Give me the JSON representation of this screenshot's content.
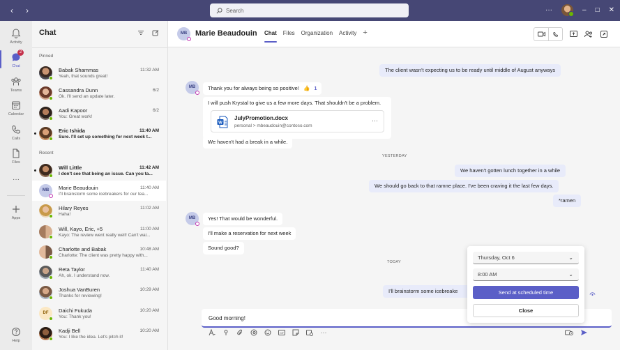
{
  "titlebar": {
    "back": "‹",
    "forward": "›",
    "search_placeholder": "Search",
    "more": "···",
    "minimize": "–",
    "maximize": "□",
    "close": "✕"
  },
  "rail": {
    "activity": "Activity",
    "chat": "Chat",
    "chat_badge": "2",
    "teams": "Teams",
    "calendar": "Calendar",
    "calls": "Calls",
    "files": "Files",
    "more": "···",
    "apps": "Apps",
    "help": "Help"
  },
  "chatlist": {
    "title": "Chat",
    "pinned_label": "Pinned",
    "recent_label": "Recent",
    "pinned": [
      {
        "name": "Babak Shammas",
        "time": "11:32 AM",
        "preview": "Yeah, that sounds great!",
        "bold": false
      },
      {
        "name": "Cassandra Dunn",
        "time": "6/2",
        "preview": "Ok. I'll send an update later.",
        "bold": false
      },
      {
        "name": "Aadi Kapoor",
        "time": "6/2",
        "preview": "You: Great work!",
        "bold": false
      },
      {
        "name": "Eric Ishida",
        "time": "11:40 AM",
        "preview": "Sure. I'll set up something for next week t...",
        "bold": true
      }
    ],
    "recent": [
      {
        "name": "Will Little",
        "time": "11:42 AM",
        "preview": "I don't see that being an issue. Can you ta...",
        "bold": true
      },
      {
        "name": "Marie Beaudouin",
        "time": "11:40 AM",
        "preview": "I'll brainstorm some icebreakers for our tea...",
        "bold": false,
        "initials": "MB"
      },
      {
        "name": "Hilary Reyes",
        "time": "11:02 AM",
        "preview": "Haha!",
        "bold": false
      },
      {
        "name": "Will, Kayo, Eric, +5",
        "time": "11:00 AM",
        "preview": "Kayo: The review went really well! Can't wai...",
        "bold": false
      },
      {
        "name": "Charlotte and Babak",
        "time": "10:48 AM",
        "preview": "Charlotte: The client was pretty happy with...",
        "bold": false
      },
      {
        "name": "Reta Taylor",
        "time": "11:40 AM",
        "preview": "Ah, ok. I understand now.",
        "bold": false
      },
      {
        "name": "Joshua VanBuren",
        "time": "10:29 AM",
        "preview": "Thanks for reviewing!",
        "bold": false
      },
      {
        "name": "Daichi Fukuda",
        "time": "10:20 AM",
        "preview": "You: Thank you!",
        "bold": false,
        "initials": "DF"
      },
      {
        "name": "Kadji Bell",
        "time": "10:20 AM",
        "preview": "You: I like the idea. Let's pitch it!",
        "bold": false
      }
    ]
  },
  "conversation": {
    "initials": "MB",
    "name": "Marie Beaudouin",
    "tabs": [
      "Chat",
      "Files",
      "Organization",
      "Activity"
    ],
    "add_tab": "+",
    "messages": {
      "out1": "The client wasn't expecting us to be ready until middle of August anyways",
      "in1": "Thank you for always being so positive!",
      "in1_reaction_emoji": "👍",
      "in1_reaction_count": "1",
      "in2": "I will push Krystal to give us a few more days. That shouldn't be a problem.",
      "file_name": "JulyPromotion.docx",
      "file_path": "personal > mbeaudouin@contoso.com",
      "file_more": "···",
      "in3": "We haven't had a break in a while.",
      "divider_yesterday": "YESTERDAY",
      "out2": "We haven't gotten lunch together in a while",
      "out3": "We should go back to that ramne place. I've been craving it the last few days.",
      "out4": "*ramen",
      "in4": "Yes! That would be wonderful.",
      "in5": "I'll make a reservation for next week",
      "in6": "Sound good?",
      "divider_today": "TODAY",
      "out5": "I'll brainstorm some icebreake"
    },
    "compose_text": "Good morning!"
  },
  "schedule": {
    "date": "Thursday, Oct 6",
    "time": "8:00 AM",
    "send_label": "Send at scheduled time",
    "close_label": "Close"
  },
  "colors": {
    "brand": "#5b5fc7",
    "titlebar": "#464775",
    "bubble_out": "#e8ebfa",
    "presence_available": "#6bb700",
    "presence_away": "#c239b3"
  }
}
